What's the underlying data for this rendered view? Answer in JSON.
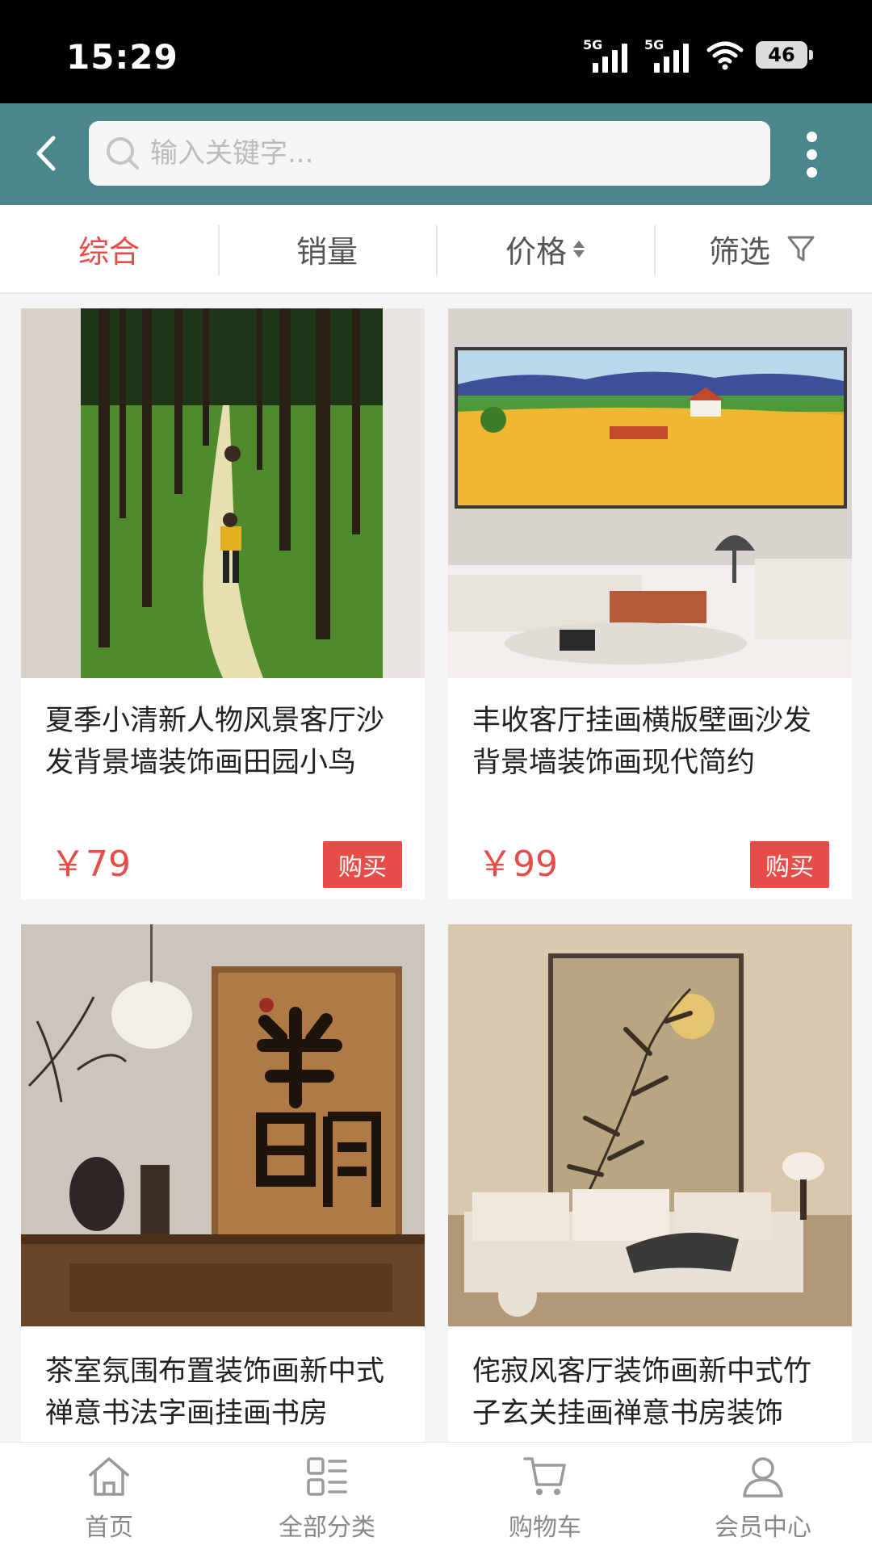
{
  "status_bar": {
    "time": "15:29",
    "signal_1": "5G",
    "signal_2": "5G",
    "battery": "46"
  },
  "header": {
    "search_placeholder": "输入关键字..."
  },
  "sort_bar": {
    "items": [
      "综合",
      "销量",
      "价格",
      "筛选"
    ],
    "active_index": 0
  },
  "products": [
    {
      "title": "夏季小清新人物风景客厅沙发背景墙装饰画田园小鸟",
      "price": "￥79",
      "buy_label": "购买",
      "image": "forest-path-painting"
    },
    {
      "title": "丰收客厅挂画横版壁画沙发背景墙装饰画现代简约",
      "price": "￥99",
      "buy_label": "购买",
      "image": "harvest-field-painting"
    },
    {
      "title": "茶室氛围布置装饰画新中式禅意书法字画挂画书房",
      "image": "calligraphy-painting"
    },
    {
      "title": "侘寂风客厅装饰画新中式竹子玄关挂画禅意书房装饰",
      "image": "bamboo-moon-painting"
    }
  ],
  "tab_bar": {
    "items": [
      "首页",
      "全部分类",
      "购物车",
      "会员中心"
    ]
  },
  "colors": {
    "header": "#4a878d",
    "accent": "#e84c48"
  }
}
